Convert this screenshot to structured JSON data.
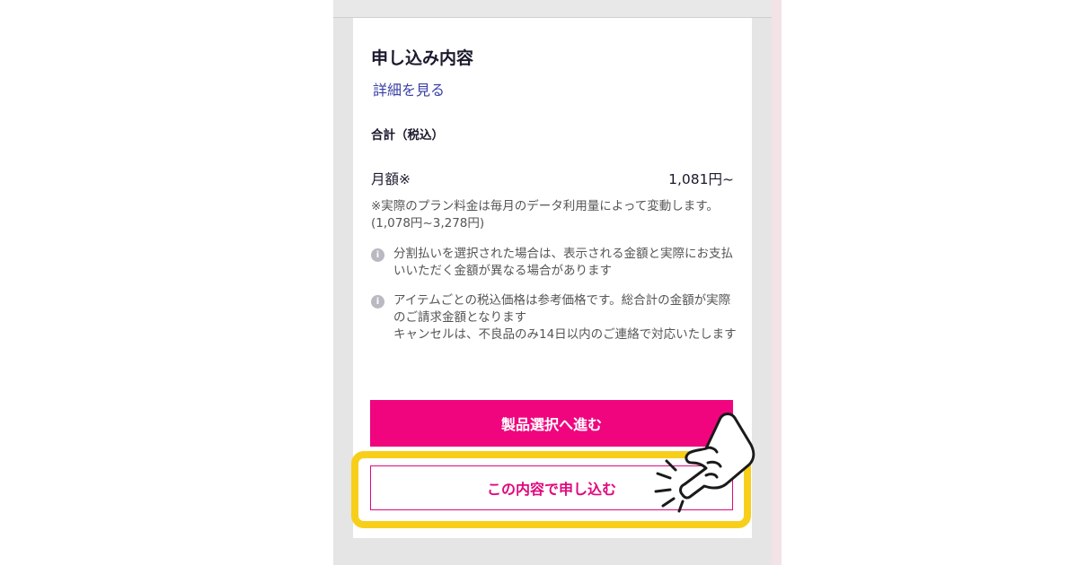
{
  "card": {
    "title": "申し込み内容",
    "details_link": "詳細を見る",
    "total_label": "合計（税込）",
    "monthly_label": "月額※",
    "monthly_value": "1,081円~",
    "note": "※実際のプラン料金は毎月のデータ利用量によって変動します。(1,078円~3,278円)",
    "info_items": [
      {
        "icon": "info-icon",
        "lines": [
          "分割払いを選択された場合は、表示される金額と実際にお支払いいただく金額が異なる場合があります"
        ]
      },
      {
        "icon": "info-icon",
        "lines": [
          "アイテムごとの税込価格は参考価格です。総合計の金額が実際のご請求金額となります",
          "キャンセルは、不良品のみ14日以内のご連絡で対応いたします"
        ]
      }
    ]
  },
  "buttons": {
    "primary": "製品選択へ進む",
    "secondary": "この内容で申し込む"
  },
  "colors": {
    "brand_pink": "#f0057f",
    "link_blue": "#3a3fa6",
    "highlight_yellow": "#f7cf1b"
  },
  "overlay": {
    "icon": "pointing-hand-icon"
  }
}
